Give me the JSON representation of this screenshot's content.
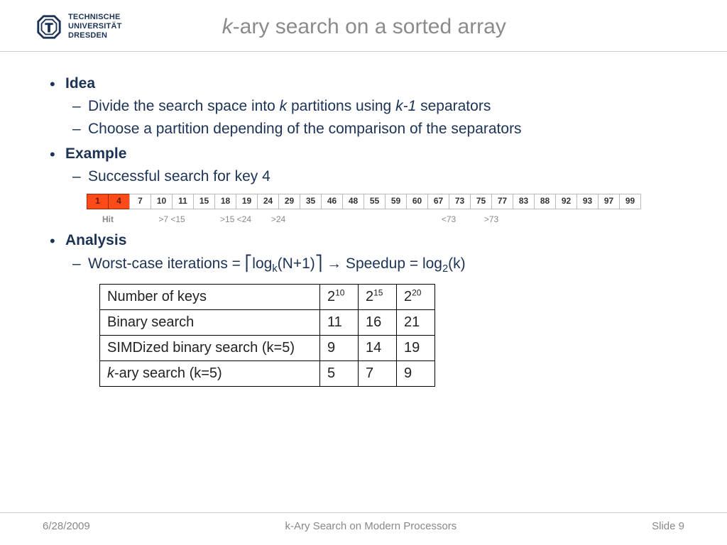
{
  "logo": {
    "line1": "TECHNISCHE",
    "line2": "UNIVERSITÄT",
    "line3": "DRESDEN"
  },
  "title": {
    "k": "k",
    "rest": "-ary search on a sorted array"
  },
  "idea": {
    "heading": "Idea",
    "p1a": "Divide the search space into ",
    "p1b": " partitions using ",
    "p1c": " separators",
    "k": "k",
    "km1": "k-1",
    "p2": "Choose a partition depending of the comparison of the separators"
  },
  "example": {
    "heading": "Example",
    "sub": "Successful search for key 4",
    "cells": [
      "1",
      "4",
      "7",
      "10",
      "11",
      "15",
      "18",
      "19",
      "24",
      "29",
      "35",
      "46",
      "48",
      "55",
      "59",
      "60",
      "67",
      "73",
      "75",
      "77",
      "83",
      "88",
      "92",
      "93",
      "97",
      "99"
    ],
    "hl": [
      0,
      1
    ],
    "labels": {
      "hit": "Hit",
      "l1": ">7  <15",
      "l2": ">15 <24",
      "l3": ">24",
      "l4": "<73",
      "l5": ">73"
    }
  },
  "analysis": {
    "heading": "Analysis",
    "text1": "Worst-case iterations = ",
    "ceil_l": "⎡",
    "log": "log",
    "subk": "k",
    "np1": "(N+1)",
    "ceil_r": "⎤",
    "arrow": " → Speedup = log",
    "sub2": "2",
    "kparen": "(k)"
  },
  "table": {
    "r0": {
      "label": "Number of  keys",
      "c1b": "2",
      "c1e": "10",
      "c2b": "2",
      "c2e": "15",
      "c3b": "2",
      "c3e": "20"
    },
    "r1": {
      "label": "Binary search",
      "c1": "11",
      "c2": "16",
      "c3": "21"
    },
    "r2": {
      "label": "SIMDized binary search (k=5)",
      "c1": "9",
      "c2": "14",
      "c3": "19"
    },
    "r3": {
      "labelA": "k",
      "labelB": "-ary search (k=5)",
      "c1": "5",
      "c2": "7",
      "c3": "9"
    }
  },
  "footer": {
    "date": "6/28/2009",
    "center": "k-Ary Search on Modern Processors",
    "right": "Slide 9"
  }
}
